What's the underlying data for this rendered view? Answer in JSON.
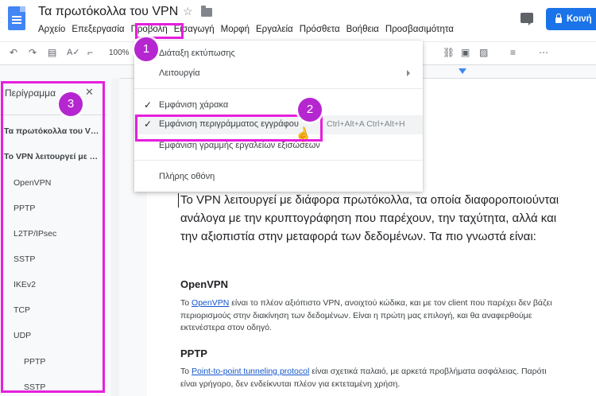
{
  "header": {
    "title": "Τα πρωτόκολλα του VPN",
    "menu": [
      "Αρχείο",
      "Επεξεργασία",
      "Προβολή",
      "Εισαγωγή",
      "Μορφή",
      "Εργαλεία",
      "Πρόσθετα",
      "Βοήθεια",
      "Προσβασιμότητα"
    ],
    "share_label": "Κοινή"
  },
  "toolbar": {
    "zoom": "100%"
  },
  "outline": {
    "title": "Περίγραμμα",
    "items": [
      "Τα πρωτόκολλα του VPN",
      "Το VPN λειτουργεί με διάφορα πρωτόκολλα",
      "OpenVPN",
      "PPTP",
      "L2TP/IPsec",
      "SSTP",
      "IKEv2",
      "TCP",
      "UDP",
      "PPTP",
      "SSTP"
    ]
  },
  "menu": {
    "items": [
      "Διάταξη εκτύπωσης",
      "Λειτουργία",
      "Εμφάνιση χάρακα",
      "Εμφάνιση περιγράμματος εγγράφου",
      "Εμφάνιση γραμμής εργαλείων εξισώσεων",
      "Πλήρης οθόνη"
    ],
    "shortcut": "Ctrl+Alt+A Ctrl+Alt+H"
  },
  "document": {
    "intro": "Το VPN λειτουργεί με διάφορα πρωτόκολλα, τα οποία διαφοροποιούνται ανάλογα με την κρυπτογράφηση που παρέχουν, την ταχύτητα, αλλά και την αξιοπιστία στην μεταφορά των δεδομένων. Τα πιο γνωστά είναι:",
    "h_openvpn": "OpenVPN",
    "openvpn_pre": "Το ",
    "openvpn_link": "OpenVPN",
    "openvpn_post": " είναι το πλέον αξιόπιστο VPN, ανοιχτού κώδικα, και με τον client που παρέχει δεν βάζει περιορισμούς στην διακίνηση των δεδομένων. Είναι η πρώτη μας επιλογή, και θα αναφερθούμε εκτενέστερα στον οδηγό.",
    "h_pptp": "PPTP",
    "pptp_pre": "Το ",
    "pptp_link": "Point-to-point tunneling protocol",
    "pptp_post": " είναι σχετικά παλαιό, με αρκετά προβλήματα ασφάλειας. Παρότι είναι γρήγορο, δεν ενδείκνυται πλέον για εκτεταμένη χρήση."
  },
  "annotations": [
    "1",
    "2",
    "3"
  ],
  "colors": {
    "annotation": "#e61fdd",
    "badge": "#b526d0",
    "share": "#1a73e8"
  }
}
